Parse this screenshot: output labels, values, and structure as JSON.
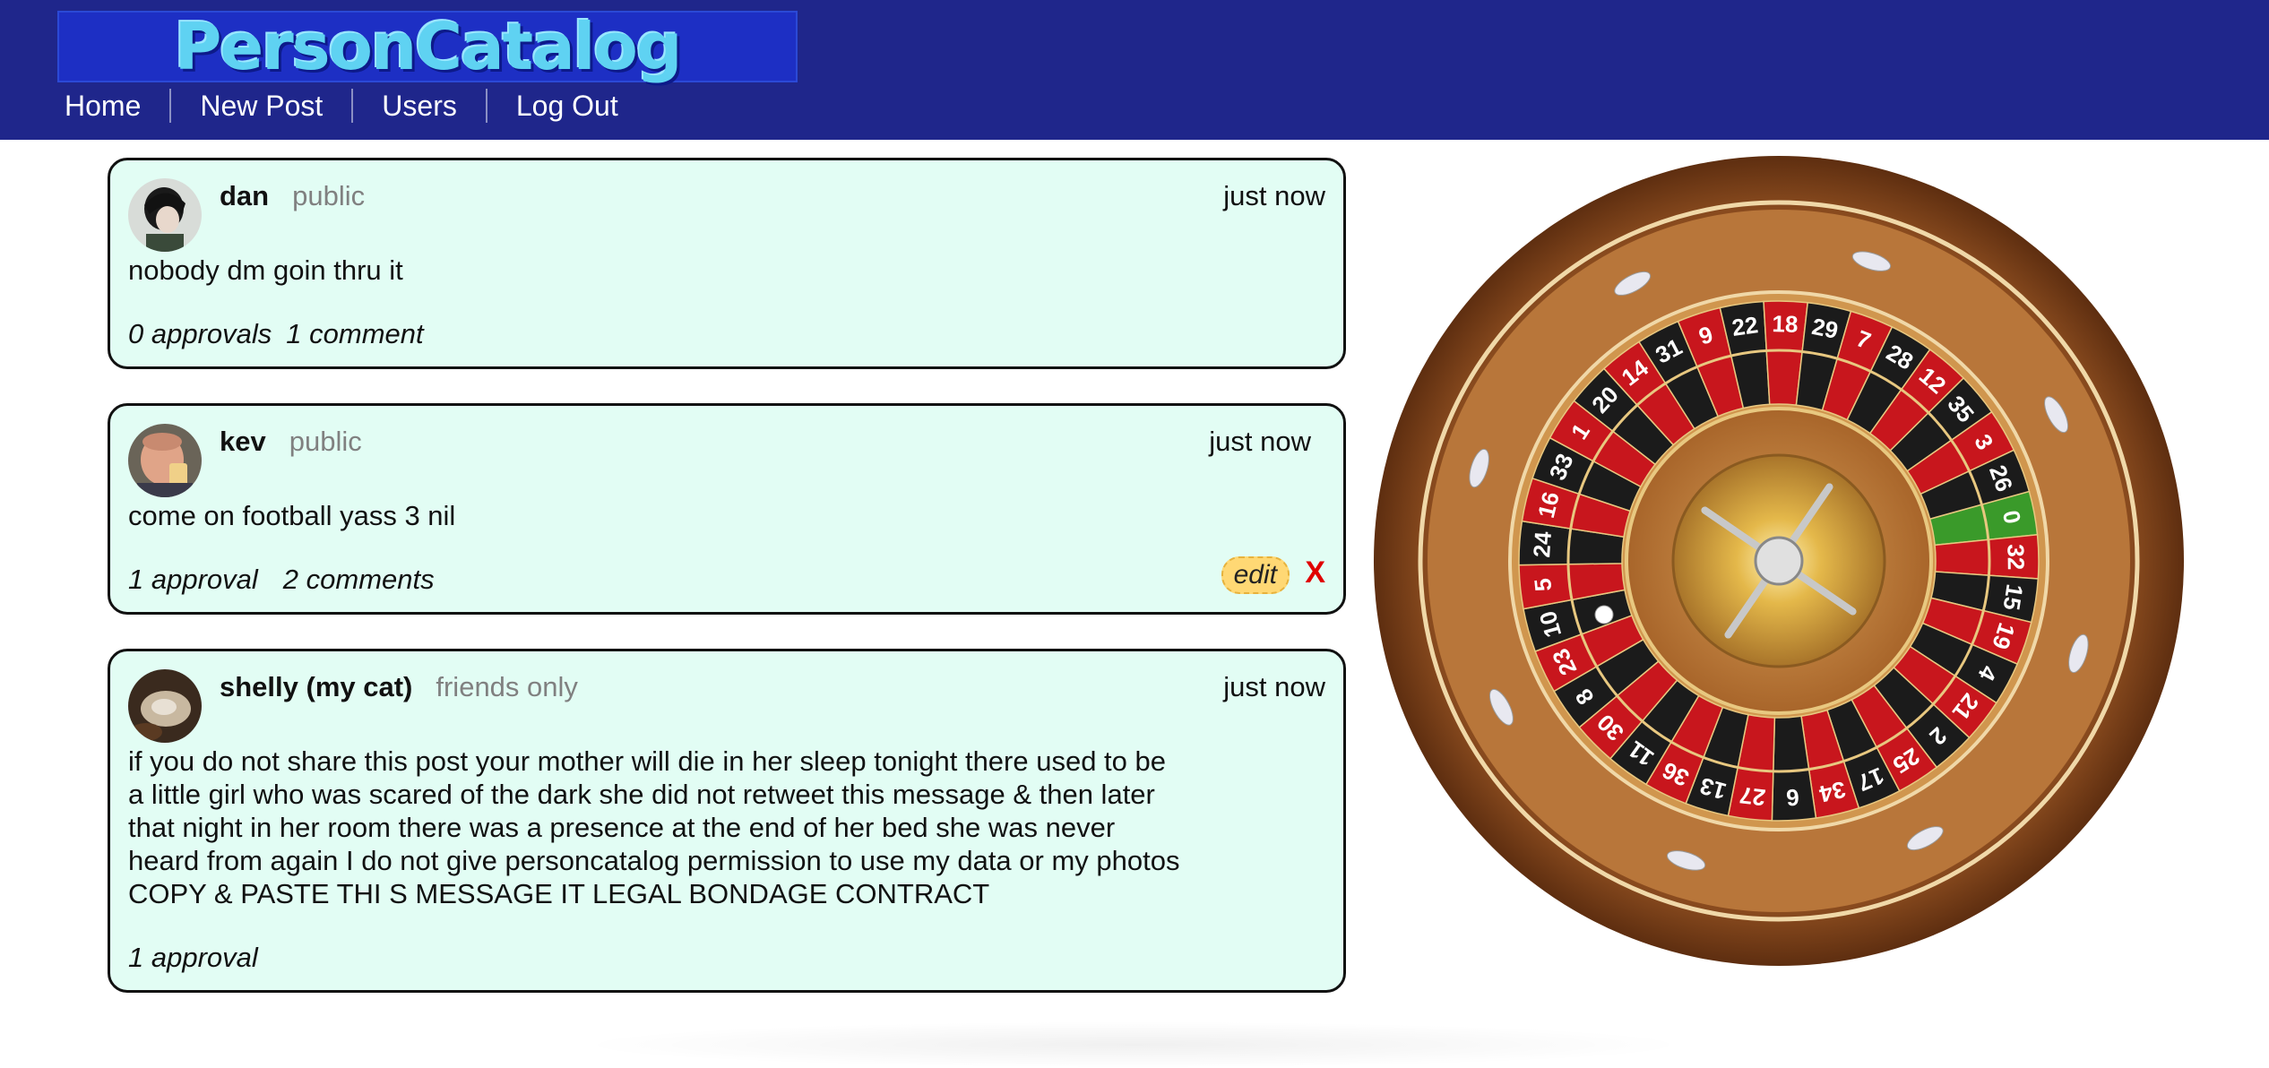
{
  "header": {
    "logo": "PersonCatalog",
    "nav": [
      "Home",
      "New Post",
      "Users",
      "Log Out"
    ]
  },
  "posts": [
    {
      "author": "dan",
      "privacy": "public",
      "time": "just now",
      "content": "nobody dm goin thru it",
      "approvals": "0 approvals",
      "comments": "1 comment"
    },
    {
      "author": "kev",
      "privacy": "public",
      "time": "just now",
      "content": "come on football yass 3 nil",
      "approvals": "1 approval",
      "comments": "2 comments",
      "edit_label": "edit",
      "delete_label": "X"
    },
    {
      "author": "shelly (my cat)",
      "privacy": "friends only",
      "time": "just now",
      "content": "if you do not share this post your mother will die in her sleep tonight there used to be\na little girl who was scared of the dark she did not retweet this message & then later\nthat night in her room there was a presence at the end of her bed she was never\nheard from again I do not give personcatalog permission to use my data or my photos\nCOPY & PASTE THI S MESSAGE IT LEGAL BONDAGE CONTRACT",
      "approvals": "1 approval"
    }
  ],
  "roulette": {
    "numbers": [
      "0",
      "32",
      "15",
      "19",
      "4",
      "21",
      "2",
      "25",
      "17",
      "34",
      "6",
      "27",
      "13",
      "36",
      "11",
      "30",
      "8",
      "23",
      "10",
      "5",
      "24",
      "16",
      "33",
      "1",
      "20",
      "14",
      "31",
      "9",
      "22",
      "18",
      "29",
      "7",
      "28",
      "12",
      "35",
      "3",
      "26"
    ],
    "colors": {
      "red": "#c8161d",
      "black": "#1b1b1b",
      "green": "#3a9a2a",
      "wood": "#8a4a1e",
      "gold": "#d8a842"
    }
  }
}
